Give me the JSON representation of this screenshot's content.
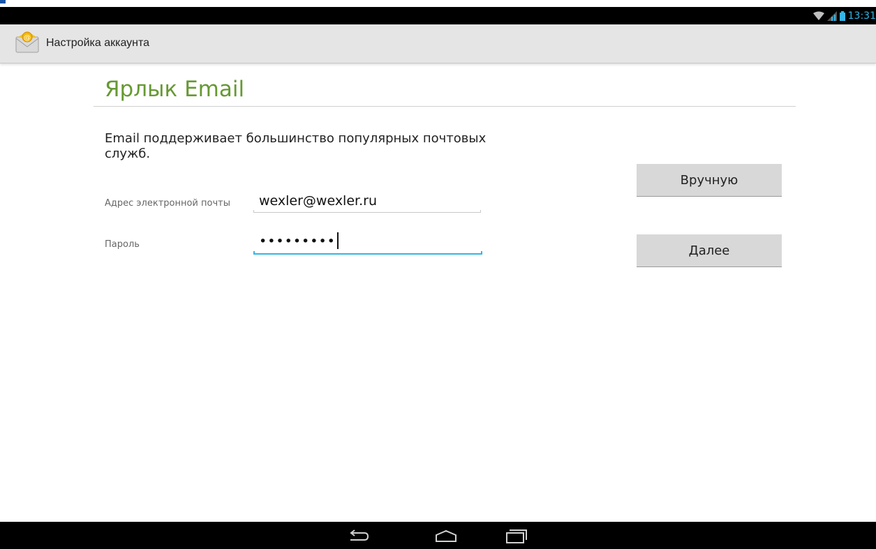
{
  "status_bar": {
    "time": "13:31",
    "icons": [
      "wifi-icon",
      "signal-icon",
      "battery-icon"
    ],
    "accent_color": "#33b5e5"
  },
  "action_bar": {
    "icon": "email-app-icon",
    "title": "Настройка аккаунта"
  },
  "form": {
    "heading": "Ярлык Email",
    "heading_color": "#669933",
    "intro": "Email поддерживает большинство популярных почтовых служб.",
    "email_label": "Адрес электронной почты",
    "email_value": "wexler@wexler.ru",
    "password_label": "Пароль",
    "password_value": "•••••••••",
    "focused_field": "password"
  },
  "buttons": {
    "manual_label": "Вручную",
    "next_label": "Далее"
  },
  "nav_bar": {
    "icons": [
      "back-icon",
      "home-icon",
      "recents-icon"
    ]
  }
}
